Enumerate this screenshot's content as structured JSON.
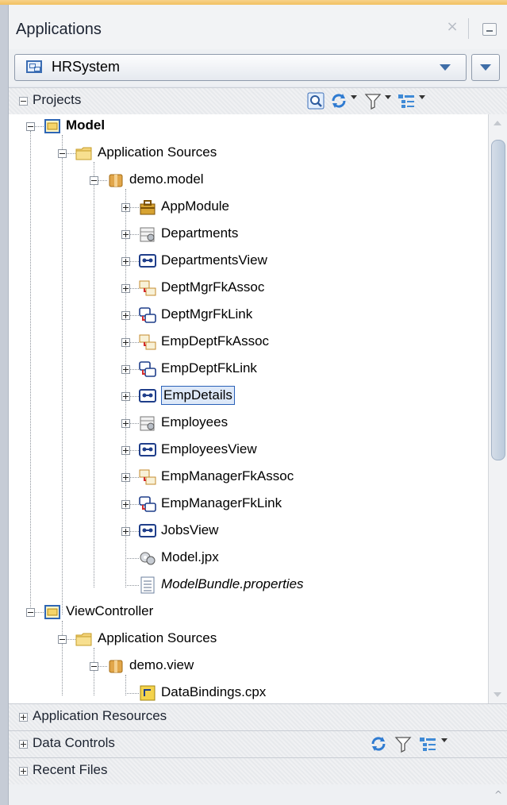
{
  "header": {
    "title": "Applications",
    "close_glyph": "×"
  },
  "app_selector": {
    "value": "HRSystem"
  },
  "projects_panel": {
    "label": "Projects"
  },
  "tree": {
    "nodes": [
      {
        "label": "Model",
        "icon": "project-icon",
        "depth": 0,
        "expander": "minus",
        "bold": true
      },
      {
        "label": "Application Sources",
        "icon": "folder-icon",
        "depth": 1,
        "expander": "minus"
      },
      {
        "label": "demo.model",
        "icon": "package-icon",
        "depth": 2,
        "expander": "minus"
      },
      {
        "label": "AppModule",
        "icon": "app-module-icon",
        "depth": 3,
        "expander": "plus"
      },
      {
        "label": "Departments",
        "icon": "entity-object-icon",
        "depth": 3,
        "expander": "plus"
      },
      {
        "label": "DepartmentsView",
        "icon": "view-object-icon",
        "depth": 3,
        "expander": "plus"
      },
      {
        "label": "DeptMgrFkAssoc",
        "icon": "association-icon",
        "depth": 3,
        "expander": "plus"
      },
      {
        "label": "DeptMgrFkLink",
        "icon": "view-link-icon",
        "depth": 3,
        "expander": "plus"
      },
      {
        "label": "EmpDeptFkAssoc",
        "icon": "association-icon",
        "depth": 3,
        "expander": "plus"
      },
      {
        "label": "EmpDeptFkLink",
        "icon": "view-link-icon",
        "depth": 3,
        "expander": "plus"
      },
      {
        "label": "EmpDetails",
        "icon": "view-object-icon",
        "depth": 3,
        "expander": "plus",
        "selected": true
      },
      {
        "label": "Employees",
        "icon": "entity-object-icon",
        "depth": 3,
        "expander": "plus"
      },
      {
        "label": "EmployeesView",
        "icon": "view-object-icon",
        "depth": 3,
        "expander": "plus"
      },
      {
        "label": "EmpManagerFkAssoc",
        "icon": "association-icon",
        "depth": 3,
        "expander": "plus"
      },
      {
        "label": "EmpManagerFkLink",
        "icon": "view-link-icon",
        "depth": 3,
        "expander": "plus"
      },
      {
        "label": "JobsView",
        "icon": "view-object-icon",
        "depth": 3,
        "expander": "plus"
      },
      {
        "label": "Model.jpx",
        "icon": "jpx-file-icon",
        "depth": 3,
        "expander": "none"
      },
      {
        "label": "ModelBundle.properties",
        "icon": "properties-file-icon",
        "depth": 3,
        "expander": "none",
        "italic": true
      },
      {
        "label": "ViewController",
        "icon": "project-icon",
        "depth": 0,
        "expander": "minus"
      },
      {
        "label": "Application Sources",
        "icon": "folder-icon",
        "depth": 1,
        "expander": "minus"
      },
      {
        "label": "demo.view",
        "icon": "package-icon",
        "depth": 2,
        "expander": "minus"
      },
      {
        "label": "DataBindings.cpx",
        "icon": "cpx-file-icon",
        "depth": 3,
        "expander": "none"
      }
    ]
  },
  "sections": {
    "application_resources": "Application Resources",
    "data_controls": "Data Controls",
    "recent_files": "Recent Files"
  },
  "colors": {
    "accent": "#2b61b8",
    "selection_bg": "#dde8f8",
    "header_stripe": "#f2c060"
  }
}
